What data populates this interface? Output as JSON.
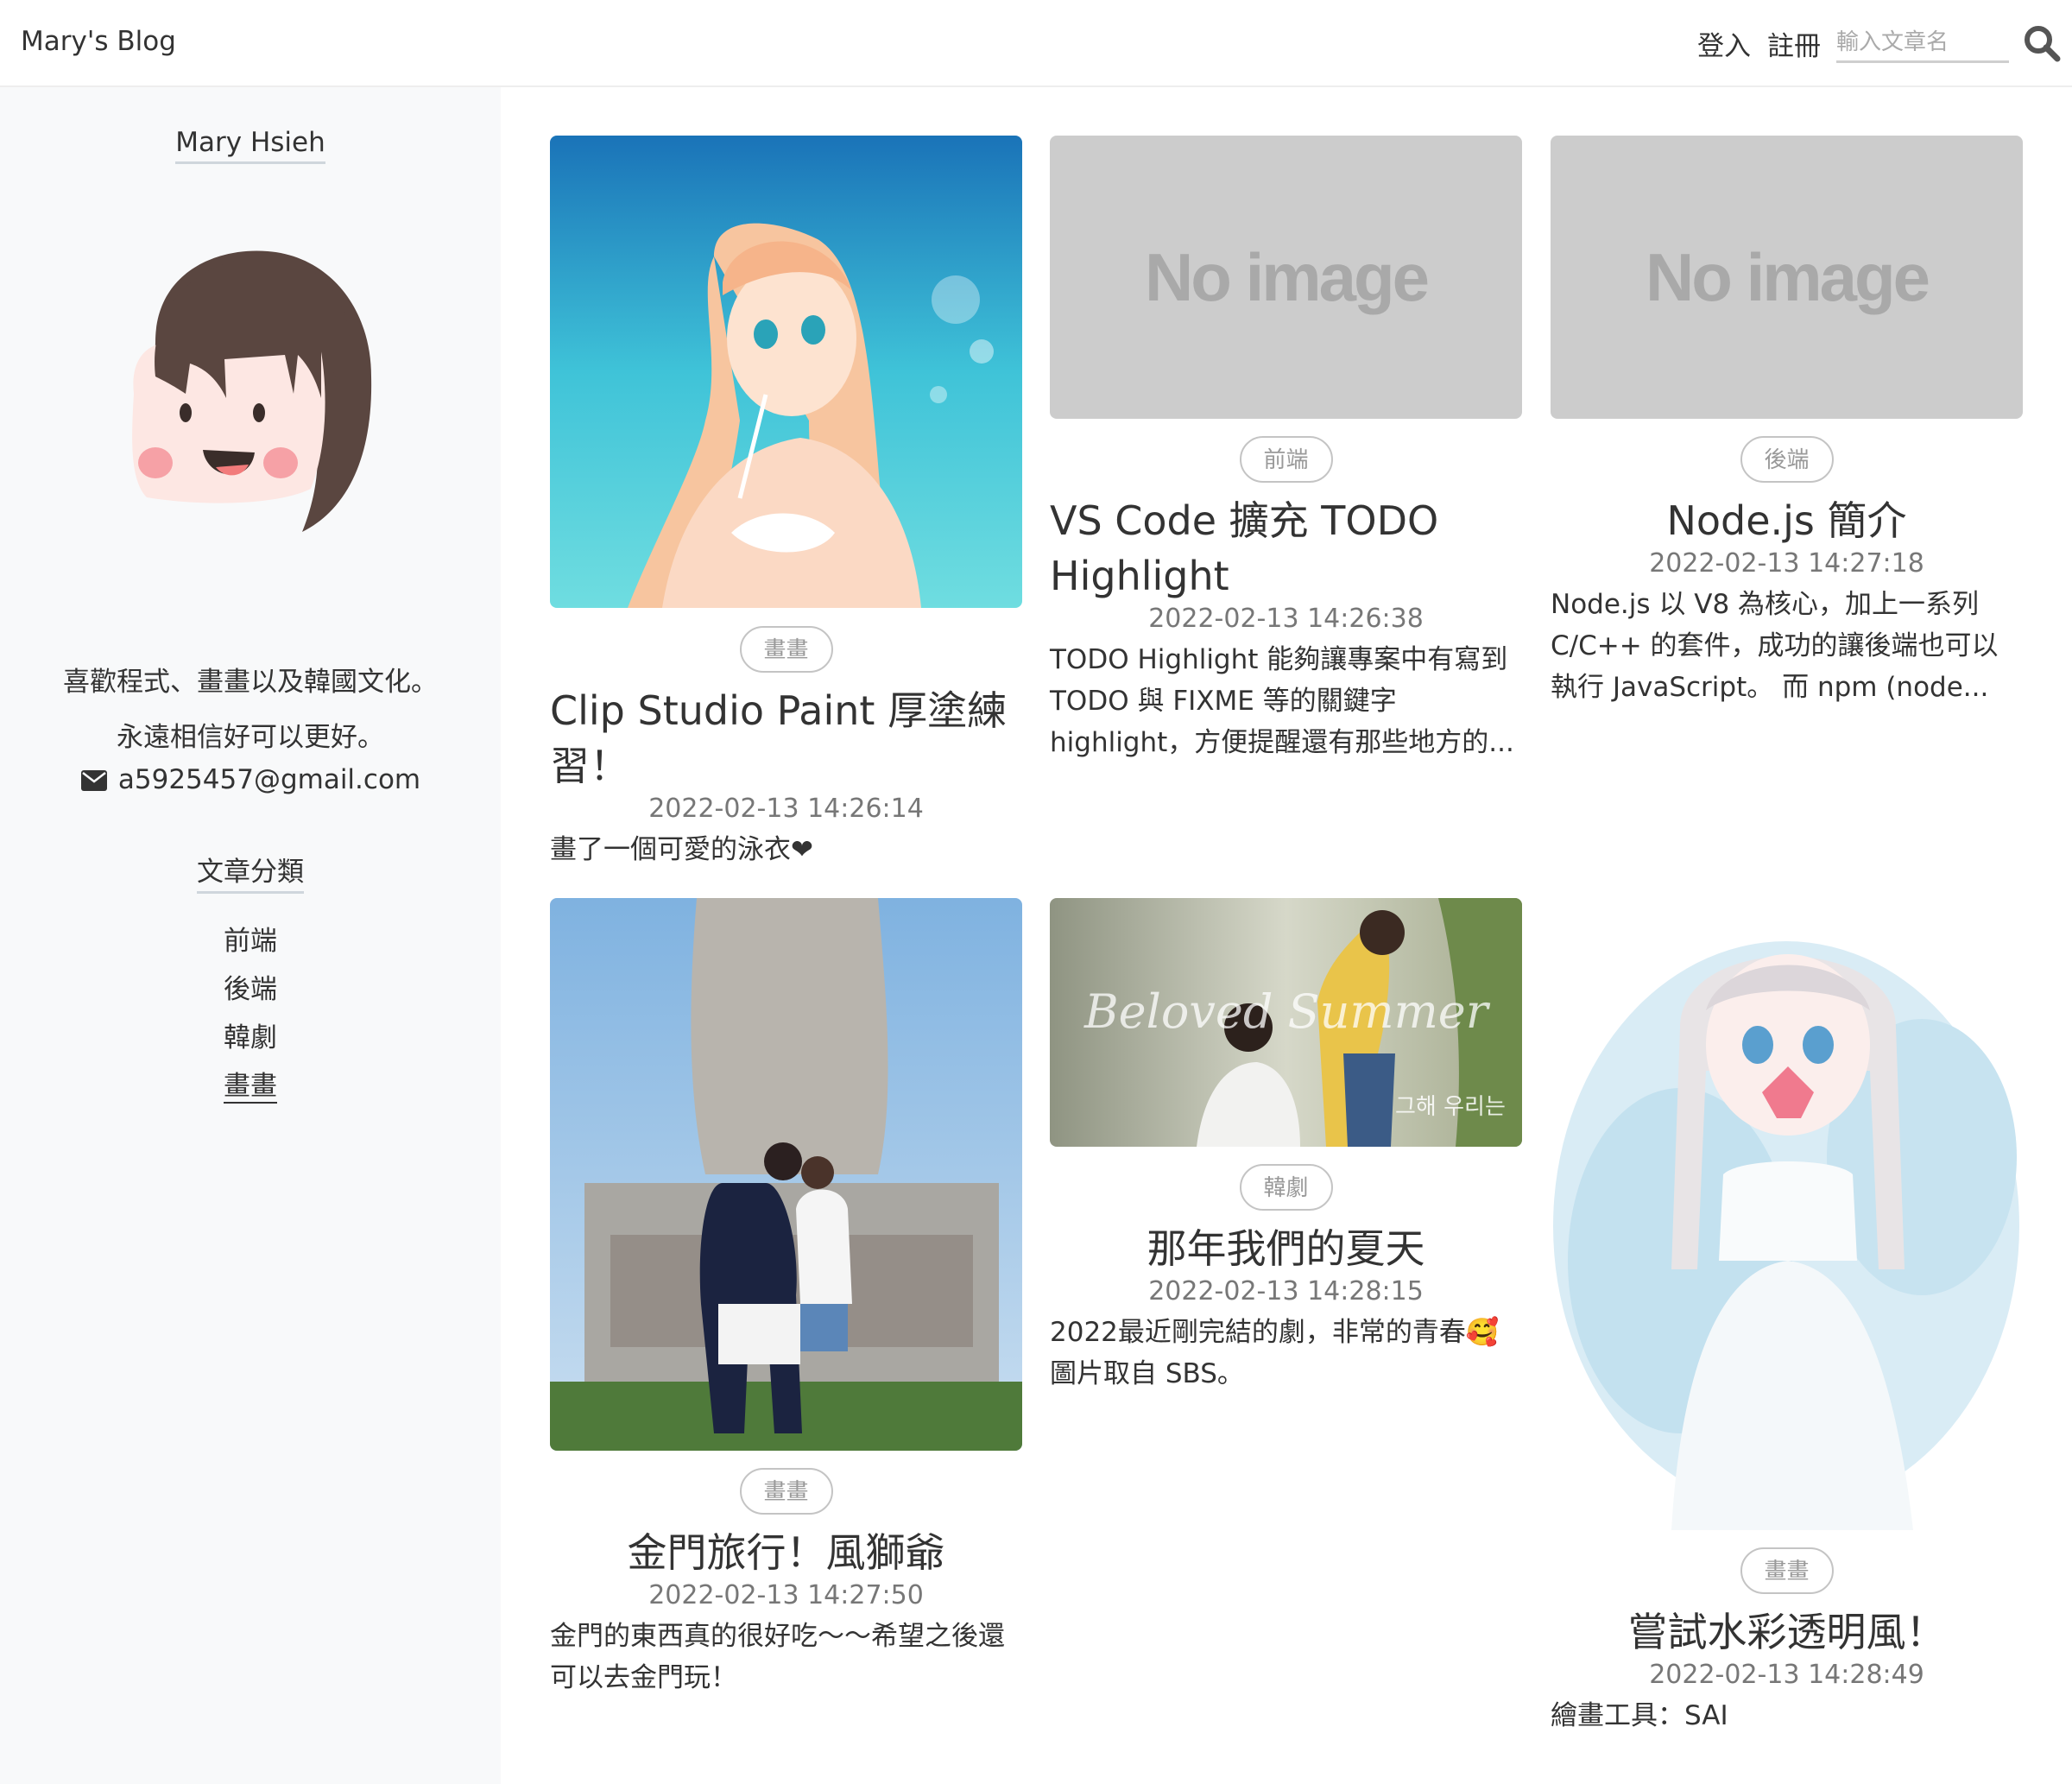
{
  "nav": {
    "brand": "Mary's Blog",
    "login": "登入",
    "register": "註冊",
    "search_placeholder": "輸入文章名"
  },
  "sidebar": {
    "author": "Mary Hsieh",
    "bio_line1": "喜歡程式、畫畫以及韓國文化。",
    "bio_line2": "永遠相信好可以更好。",
    "email": "a5925457@gmail.com",
    "categories_heading": "文章分類",
    "categories": [
      "前端",
      "後端",
      "韓劇",
      "畫畫"
    ]
  },
  "posts": [
    {
      "tag": "畫畫",
      "title": "Clip Studio Paint 厚塗練習！",
      "date": "2022-02-13 14:26:14",
      "excerpt": "畫了一個可愛的泳衣❤"
    },
    {
      "tag": "前端",
      "title": "VS Code 擴充 TODO Highlight",
      "date": "2022-02-13 14:26:38",
      "excerpt": "TODO Highlight 能夠讓專案中有寫到 TODO 與 FIXME 等的關鍵字 highlight，方便提醒還有那些地方的...",
      "image_text": "No image"
    },
    {
      "tag": "後端",
      "title": "Node.js 簡介",
      "date": "2022-02-13 14:27:18",
      "excerpt": "Node.js 以 V8 為核心，加上一系列 C/C++ 的套件，成功的讓後端也可以執行 JavaScript。 而 npm (node...",
      "image_text": "No image"
    },
    {
      "tag": "畫畫",
      "title": "金門旅行！風獅爺",
      "date": "2022-02-13 14:27:50",
      "excerpt": "金門的東西真的很好吃～～希望之後還可以去金門玩！"
    },
    {
      "tag": "韓劇",
      "title": "那年我們的夏天",
      "date": "2022-02-13 14:28:15",
      "excerpt_line1": "2022最近剛完結的劇，非常的青春🥰",
      "excerpt_line2": "圖片取自 SBS。",
      "image_text_1": "Beloved Summer",
      "image_text_2": "그해 우리는"
    },
    {
      "tag": "畫畫",
      "title": "嘗試水彩透明風！",
      "date": "2022-02-13 14:28:49",
      "excerpt": "繪畫工具：SAI"
    }
  ],
  "colors": {
    "sidebar_bg": "#f8f9fa",
    "noimage_bg": "#cccccc",
    "text": "#333333"
  }
}
